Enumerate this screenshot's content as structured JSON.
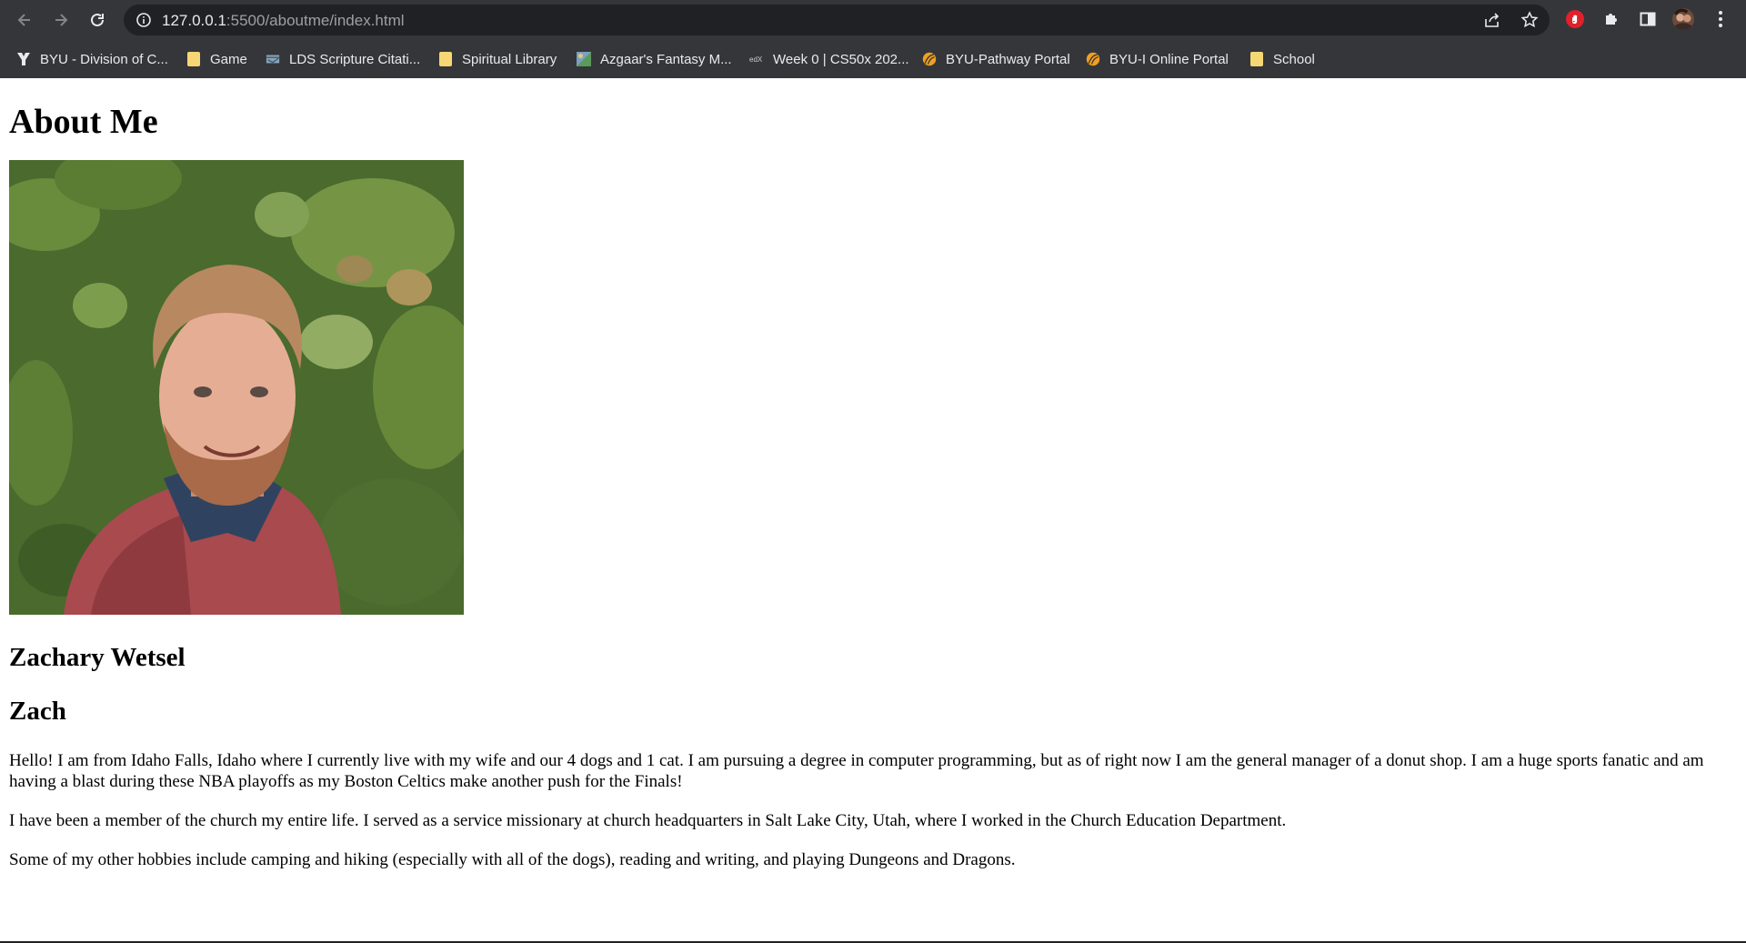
{
  "browser": {
    "url_host": "127.0.0.1",
    "url_rest": ":5500/aboutme/index.html",
    "bookmarks": [
      {
        "label": "BYU - Division of C...",
        "icon": "byu-icon"
      },
      {
        "label": "Game",
        "icon": "folder-icon"
      },
      {
        "label": "LDS Scripture Citati...",
        "icon": "scripture-icon"
      },
      {
        "label": "Spiritual Library",
        "icon": "folder-icon"
      },
      {
        "label": "Azgaar's Fantasy M...",
        "icon": "map-icon"
      },
      {
        "label": "Week 0 | CS50x 202...",
        "icon": "edx-icon"
      },
      {
        "label": "BYU-Pathway Portal",
        "icon": "pathway-icon"
      },
      {
        "label": "BYU-I Online Portal",
        "icon": "pathway-icon"
      },
      {
        "label": "School",
        "icon": "folder-icon"
      }
    ],
    "colors": {
      "chrome": "#35363a",
      "omnibox": "#202124",
      "folder": "#f7d774",
      "adblock": "#e0202a"
    }
  },
  "page": {
    "title": "About Me",
    "photo_icon": "portrait-photo",
    "full_name": "Zachary Wetsel",
    "nickname": "Zach",
    "paragraphs": [
      "Hello! I am from Idaho Falls, Idaho where I currently live with my wife and our 4 dogs and 1 cat. I am pursuing a degree in computer programming, but as of right now I am the general manager of a donut shop. I am a huge sports fanatic and am having a blast during these NBA playoffs as my Boston Celtics make another push for the Finals!",
      "I have been a member of the church my entire life. I served as a service missionary at church headquarters in Salt Lake City, Utah, where I worked in the Church Education Department.",
      "Some of my other hobbies include camping and hiking (especially with all of the dogs), reading and writing, and playing Dungeons and Dragons."
    ]
  }
}
